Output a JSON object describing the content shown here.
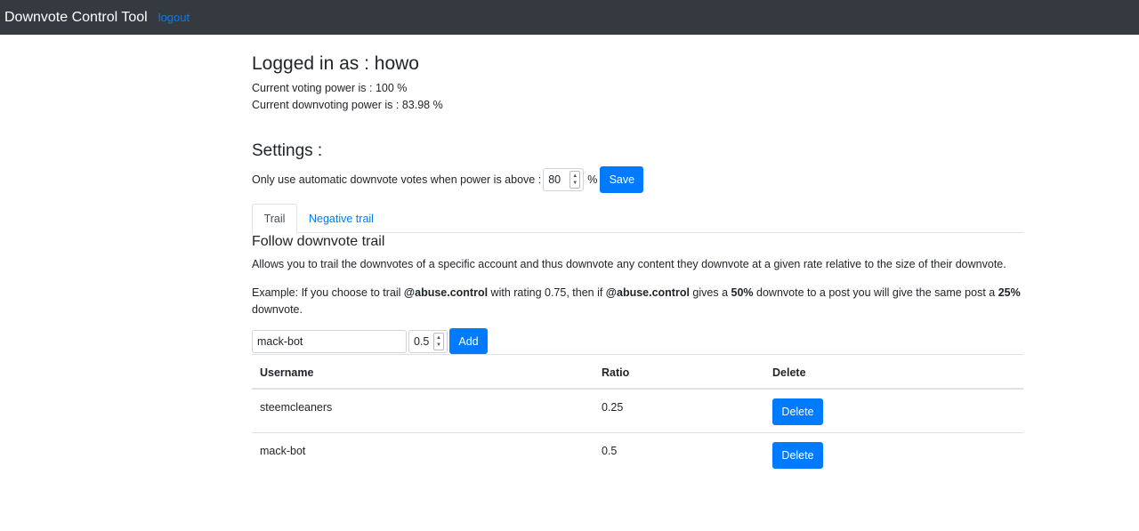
{
  "navbar": {
    "brand": "Downvote Control Tool",
    "logout": "logout"
  },
  "header": {
    "logged_in": "Logged in as : howo",
    "voting_power": "Current voting power is : 100 %",
    "downvoting_power": "Current downvoting power is : 83.98 %"
  },
  "settings": {
    "title": "Settings :",
    "label": "Only use automatic downvote votes when power is above :",
    "threshold_value": "80",
    "percent": "%",
    "save_label": "Save"
  },
  "tabs": [
    {
      "label": "Trail",
      "active": true
    },
    {
      "label": "Negative trail",
      "active": false
    }
  ],
  "trail": {
    "title": "Follow downvote trail",
    "description": "Allows you to trail the downvotes of a specific account and thus downvote any content they downvote at a given rate relative to the size of their downvote.",
    "example": {
      "p1": "Example: If you choose to trail ",
      "b1": "@abuse.control",
      "p2": " with rating 0.75, then if ",
      "b2": "@abuse.control",
      "p3": " gives a ",
      "b3": "50%",
      "p4": " downvote to a post you will give the same post a ",
      "b4": "25%",
      "p5": " downvote."
    },
    "username_value": "mack-bot",
    "ratio_value": "0.5",
    "add_label": "Add"
  },
  "table": {
    "headers": [
      "Username",
      "Ratio",
      "Delete"
    ],
    "rows": [
      {
        "username": "steemcleaners",
        "ratio": "0.25",
        "delete_label": "Delete"
      },
      {
        "username": "mack-bot",
        "ratio": "0.5",
        "delete_label": "Delete"
      }
    ]
  },
  "colors": {
    "navbar": "#343a40",
    "primary": "#007bff"
  }
}
